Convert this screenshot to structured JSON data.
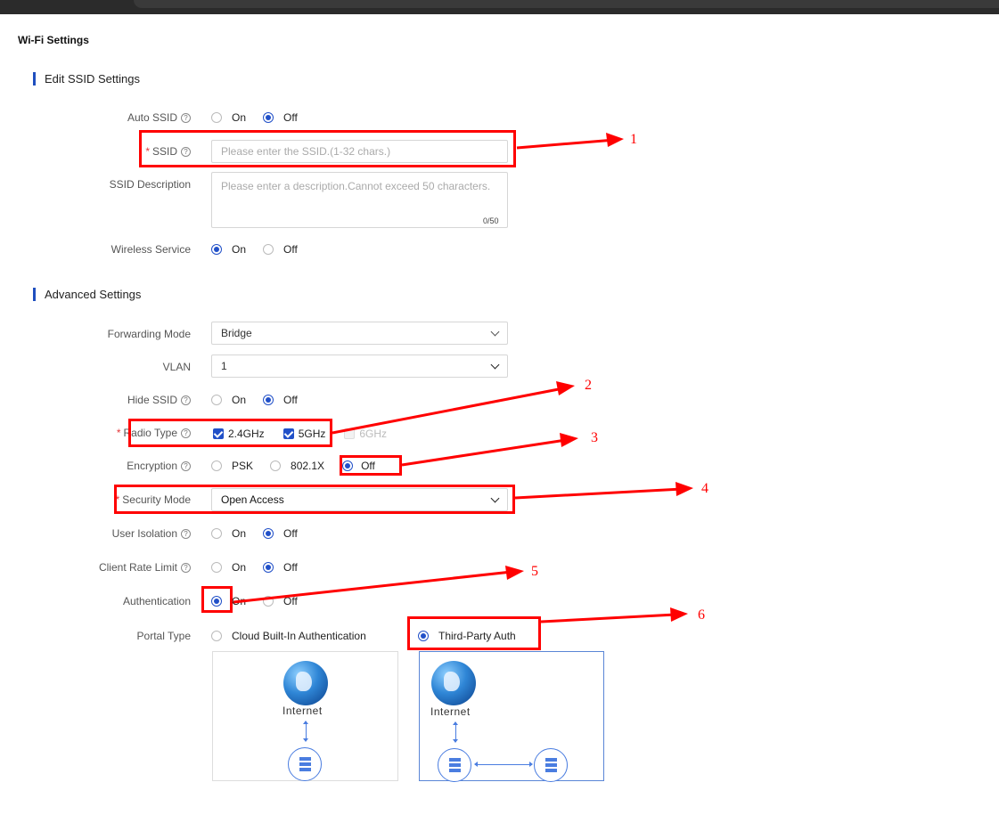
{
  "page_title": "Wi-Fi Settings",
  "sections": {
    "edit": "Edit SSID Settings",
    "advanced": "Advanced Settings"
  },
  "auto_ssid": {
    "label": "Auto SSID",
    "on": "On",
    "off": "Off",
    "selected": "Off"
  },
  "ssid": {
    "label": "SSID",
    "placeholder": "Please enter the SSID.(1-32 chars.)"
  },
  "ssid_description": {
    "label": "SSID Description",
    "placeholder": "Please enter a description.Cannot exceed 50 characters.",
    "counter": "0/50"
  },
  "wireless_service": {
    "label": "Wireless Service",
    "on": "On",
    "off": "Off",
    "selected": "On"
  },
  "forwarding_mode": {
    "label": "Forwarding Mode",
    "value": "Bridge"
  },
  "vlan": {
    "label": "VLAN",
    "value": "1"
  },
  "hide_ssid": {
    "label": "Hide SSID",
    "on": "On",
    "off": "Off",
    "selected": "Off"
  },
  "radio_type": {
    "label": "Radio Type",
    "opt1": "2.4GHz",
    "opt2": "5GHz",
    "opt3": "6GHz"
  },
  "encryption": {
    "label": "Encryption",
    "psk": "PSK",
    "dot1x": "802.1X",
    "off": "Off",
    "selected": "Off"
  },
  "security_mode": {
    "label": "Security Mode",
    "value": "Open Access"
  },
  "user_isolation": {
    "label": "User Isolation",
    "on": "On",
    "off": "Off",
    "selected": "Off"
  },
  "client_rate_limit": {
    "label": "Client Rate Limit",
    "on": "On",
    "off": "Off",
    "selected": "Off"
  },
  "authentication": {
    "label": "Authentication",
    "on": "On",
    "off": "Off",
    "selected": "On"
  },
  "portal_type": {
    "label": "Portal Type",
    "cloud": "Cloud Built-In Authentication",
    "third": "Third-Party Auth",
    "selected": "Third-Party Auth"
  },
  "diagram": {
    "internet": "Internet"
  },
  "help_glyph": "?",
  "required_mark": "*",
  "annotations": [
    "1",
    "2",
    "3",
    "4",
    "5",
    "6"
  ],
  "colors": {
    "accent": "#2150c8",
    "annotation": "#ff0000",
    "required": "#e4393c"
  }
}
